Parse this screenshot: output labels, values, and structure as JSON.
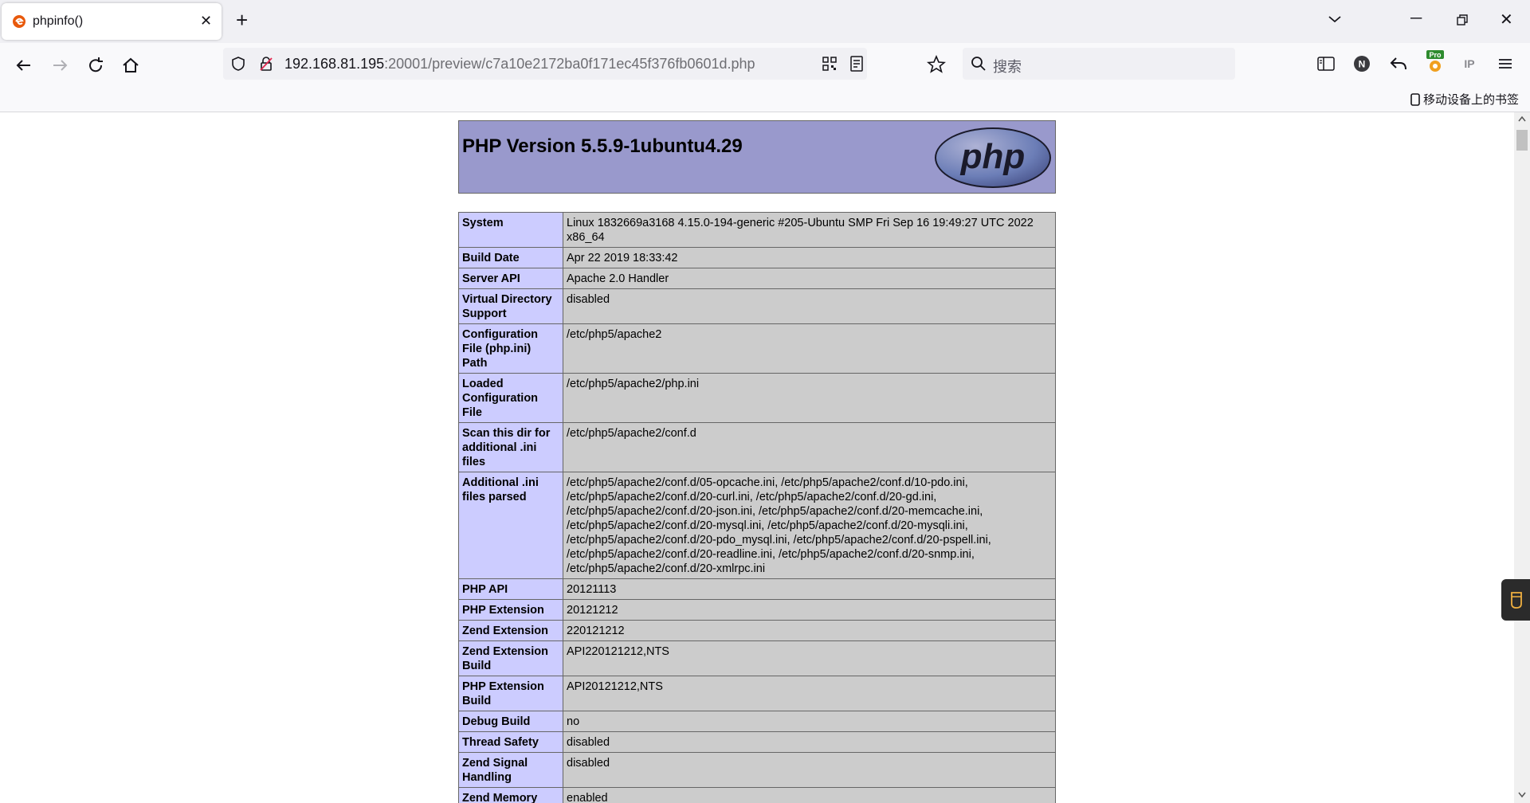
{
  "browser": {
    "tab": {
      "title": "phpinfo()"
    },
    "url_host": "192.168.81.195",
    "url_rest": ":20001/preview/c7a10e2172ba0f171ec45f376fb0601d.php",
    "search_placeholder": "搜索",
    "bookmark_mobile": "移动设备上的书签",
    "accent": "#ff7139"
  },
  "phpinfo": {
    "title": "PHP Version 5.5.9-1ubuntu4.29",
    "logo_text": "php",
    "rows": [
      {
        "k": "System",
        "v": "Linux 1832669a3168 4.15.0-194-generic #205-Ubuntu SMP Fri Sep 16 19:49:27 UTC 2022 x86_64"
      },
      {
        "k": "Build Date",
        "v": "Apr 22 2019 18:33:42"
      },
      {
        "k": "Server API",
        "v": "Apache 2.0 Handler"
      },
      {
        "k": "Virtual Directory Support",
        "v": "disabled"
      },
      {
        "k": "Configuration File (php.ini) Path",
        "v": "/etc/php5/apache2"
      },
      {
        "k": "Loaded Configuration File",
        "v": "/etc/php5/apache2/php.ini"
      },
      {
        "k": "Scan this dir for additional .ini files",
        "v": "/etc/php5/apache2/conf.d"
      },
      {
        "k": "Additional .ini files parsed",
        "v": "/etc/php5/apache2/conf.d/05-opcache.ini, /etc/php5/apache2/conf.d/10-pdo.ini, /etc/php5/apache2/conf.d/20-curl.ini, /etc/php5/apache2/conf.d/20-gd.ini, /etc/php5/apache2/conf.d/20-json.ini, /etc/php5/apache2/conf.d/20-memcache.ini, /etc/php5/apache2/conf.d/20-mysql.ini, /etc/php5/apache2/conf.d/20-mysqli.ini, /etc/php5/apache2/conf.d/20-pdo_mysql.ini, /etc/php5/apache2/conf.d/20-pspell.ini, /etc/php5/apache2/conf.d/20-readline.ini, /etc/php5/apache2/conf.d/20-snmp.ini, /etc/php5/apache2/conf.d/20-xmlrpc.ini"
      },
      {
        "k": "PHP API",
        "v": "20121113"
      },
      {
        "k": "PHP Extension",
        "v": "20121212"
      },
      {
        "k": "Zend Extension",
        "v": "220121212"
      },
      {
        "k": "Zend Extension Build",
        "v": "API220121212,NTS"
      },
      {
        "k": "PHP Extension Build",
        "v": "API20121212,NTS"
      },
      {
        "k": "Debug Build",
        "v": "no"
      },
      {
        "k": "Thread Safety",
        "v": "disabled"
      },
      {
        "k": "Zend Signal Handling",
        "v": "disabled"
      },
      {
        "k": "Zend Memory Manager",
        "v": "enabled"
      }
    ]
  }
}
